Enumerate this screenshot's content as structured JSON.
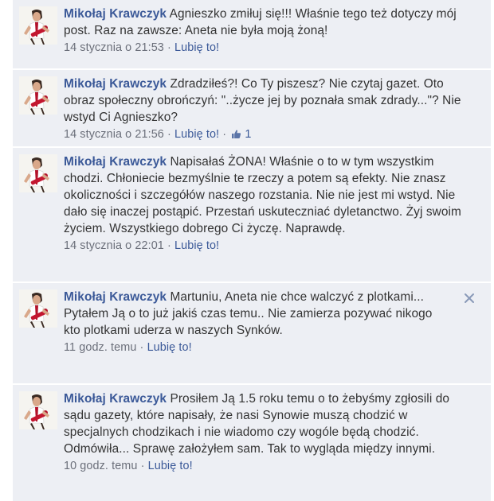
{
  "comments": [
    {
      "author": "Mikołaj Krawczyk",
      "text": "Agnieszko zmiłuj się!!! Właśnie tego też dotyczy mój post. Raz na zawsze: Aneta nie była moją żoną!",
      "time": "14 stycznia o 21:53",
      "like_label": "Lubię to!"
    },
    {
      "author": "Mikołaj Krawczyk",
      "text": "Zdradziłeś?! Co Ty piszesz? Nie czytaj gazet. Oto obraz społeczny obrończyń: \"..życze jej by poznała smak zdrady...\"? Nie wstyd Ci Agnieszko?",
      "time": "14 stycznia o 21:56",
      "like_label": "Lubię to!",
      "like_count": "1"
    },
    {
      "author": "Mikołaj Krawczyk",
      "text": "Napisałaś ŻONA! Właśnie o to w tym wszystkim chodzi. Chłoniecie bezmyślnie te rzeczy a potem są efekty. Nie znasz okoliczności i szczegółów naszego rozstania. Nie nie jest mi wstyd. Nie dało się inaczej postąpić. Przestań uskuteczniać dyletanctwo. Żyj swoim życiem. Wszystkiego dobrego Ci życzę. Naprawdę.",
      "time": "14 stycznia o 22:01",
      "like_label": "Lubię to!"
    },
    {
      "author": "Mikołaj Krawczyk",
      "text": "Martuniu, Aneta nie chce walczyć z plotkami... Pytałem Ją o to już jakiś czas temu.. Nie zamierza pozywać nikogo kto plotkami uderza w naszych Synków.",
      "time": "11 godz. temu",
      "like_label": "Lubię to!"
    },
    {
      "author": "Mikołaj Krawczyk",
      "text": "Prosiłem Ją 1.5 roku temu o to żebyśmy zgłosili do sądu gazety, które napisały, że nasi Synowie muszą chodzić w specjalnych chodzikach i nie wiadomo czy wogóle będą chodzić. Odmówiła... Sprawę założyłem sam. Tak to wygląda między innymi.",
      "time": "10 godz. temu",
      "like_label": "Lubię to!"
    }
  ],
  "separator": "·",
  "colors": {
    "link": "#3b5998",
    "comment_bg": "#edeff4",
    "meta": "#6b6f7a",
    "text": "#333333"
  },
  "icons": {
    "avatar": "user-photo-avatar",
    "like_count": "thumbs-up-icon",
    "remove": "close-icon"
  }
}
